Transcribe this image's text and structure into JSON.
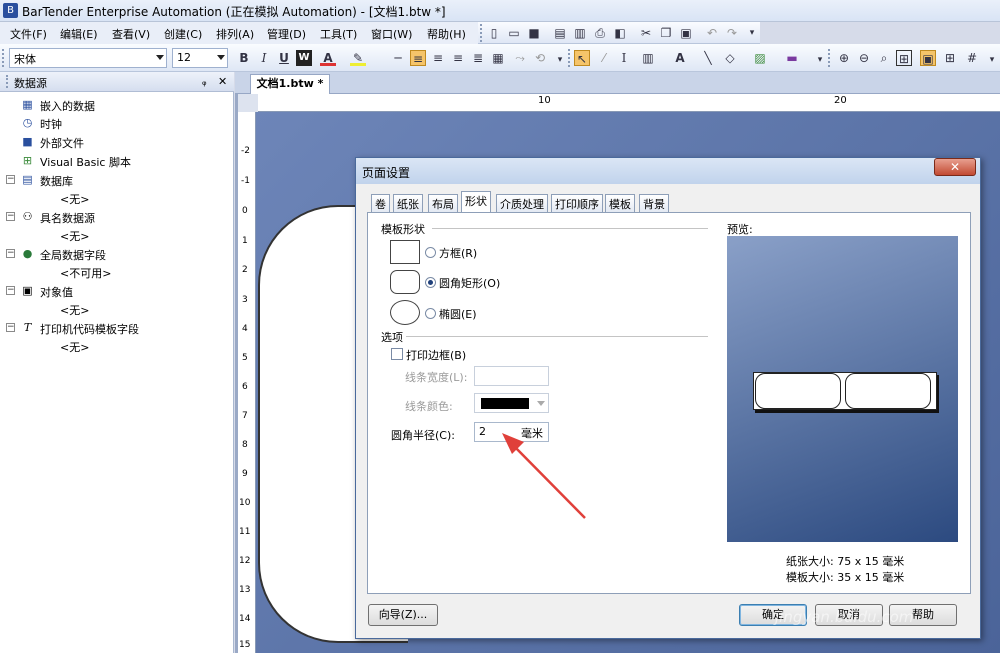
{
  "window": {
    "title": "BarTender Enterprise Automation (正在模拟 Automation) - [文档1.btw *]"
  },
  "menu": [
    "文件(F)",
    "编辑(E)",
    "查看(V)",
    "创建(C)",
    "排列(A)",
    "管理(D)",
    "工具(T)",
    "窗口(W)",
    "帮助(H)"
  ],
  "format_toolbar": {
    "font": "宋体",
    "size": "12"
  },
  "sidebar": {
    "title": "数据源",
    "pin": "ᵩ",
    "close": "✕",
    "items": [
      {
        "label": "嵌入的数据"
      },
      {
        "label": "时钟"
      },
      {
        "label": "外部文件"
      },
      {
        "label": "Visual Basic 脚本"
      },
      {
        "label": "数据库"
      },
      {
        "label": "<无>"
      },
      {
        "label": "具名数据源"
      },
      {
        "label": "<无>"
      },
      {
        "label": "全局数据字段"
      },
      {
        "label": "<不可用>"
      },
      {
        "label": "对象值"
      },
      {
        "label": "<无>"
      },
      {
        "label": "打印机代码模板字段"
      },
      {
        "label": "<无>"
      }
    ]
  },
  "document": {
    "tab": "文档1.btw *",
    "ruler_h": [
      "10",
      "20"
    ],
    "ruler_v": [
      "-2",
      "-1",
      "0",
      "1",
      "2",
      "3",
      "4",
      "5",
      "6",
      "7",
      "8",
      "9",
      "10",
      "11",
      "12",
      "13",
      "14",
      "15"
    ]
  },
  "dialog": {
    "title": "页面设置",
    "tabs": [
      "卷",
      "纸张",
      "布局",
      "形状",
      "介质处理",
      "打印顺序",
      "模板",
      "背景"
    ],
    "active_tab": "形状",
    "template_shape": {
      "heading": "模板形状",
      "options": [
        {
          "label": "方框(R)",
          "selected": false
        },
        {
          "label": "圆角矩形(O)",
          "selected": true
        },
        {
          "label": "椭圆(E)",
          "selected": false
        }
      ]
    },
    "options": {
      "heading": "选项",
      "print_border": "打印边框(B)",
      "line_width_label": "线条宽度(L):",
      "line_color_label": "线条颜色:",
      "corner_radius_label": "圆角半径(C):",
      "corner_radius_value": "2",
      "corner_radius_unit": "毫米"
    },
    "preview": {
      "heading": "预览:",
      "paper_size": "纸张大小: 75 x 15 毫米",
      "template_size": "模板大小: 35 x 15 毫米"
    },
    "buttons": {
      "wizard": "向导(Z)...",
      "ok": "确定",
      "cancel": "取消",
      "help": "帮助"
    },
    "watermark": "jingyan.baidu.com"
  },
  "colors": {
    "accent": "#1f3f7a",
    "annotation_arrow": "#e0403a"
  }
}
